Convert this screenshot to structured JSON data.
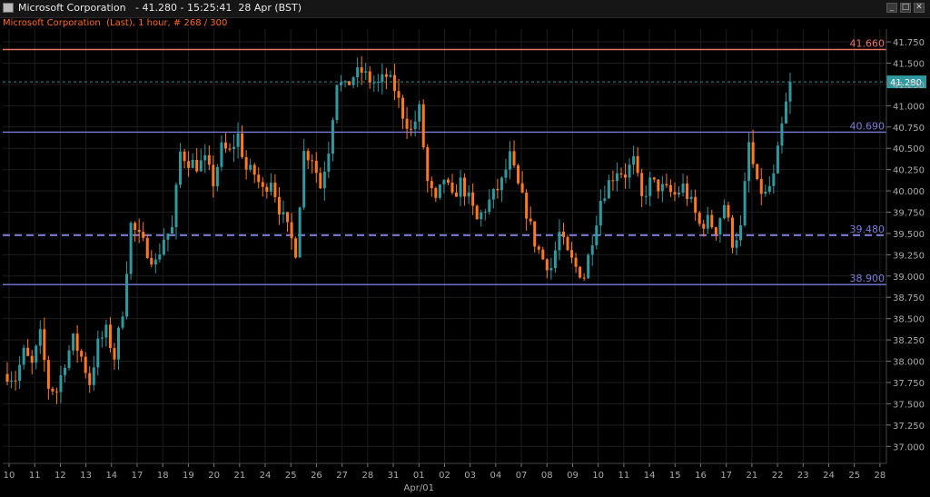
{
  "window": {
    "title": "Microsoft Corporation   - 41.280 - 15:25:41  28 Apr (BST)",
    "subtitle": "Microsoft Corporation  (Last), 1 hour, # 268 / 300",
    "controls": [
      "_",
      "□",
      "✕"
    ]
  },
  "colors": {
    "up": "#2e9aa0",
    "down": "#ff7a1e",
    "grid": "#1d1d1d",
    "axis": "#aaaaaa",
    "background": "#000000"
  },
  "chart_data": {
    "type": "candlestick",
    "title": "Microsoft Corporation",
    "ylim": [
      36.8,
      41.9
    ],
    "y_ticks": [
      "37.000",
      "37.250",
      "37.500",
      "37.750",
      "38.000",
      "38.250",
      "38.500",
      "38.750",
      "39.000",
      "39.250",
      "39.500",
      "39.750",
      "40.000",
      "40.250",
      "40.500",
      "40.750",
      "41.000",
      "41.250",
      "41.500",
      "41.750"
    ],
    "x_ticks": [
      "10",
      "11",
      "12",
      "13",
      "14",
      "17",
      "18",
      "19",
      "20",
      "21",
      "24",
      "25",
      "26",
      "27",
      "28",
      "31",
      "01",
      "02",
      "03",
      "04",
      "07",
      "08",
      "09",
      "10",
      "11",
      "14",
      "15",
      "16",
      "17",
      "21",
      "22",
      "23",
      "24",
      "25",
      "28"
    ],
    "x_sublabel": {
      "under": "01",
      "text": "Apr/01"
    },
    "last_price": {
      "label": "41.280",
      "value": 41.28
    },
    "levels": [
      {
        "label": "41.660",
        "value": 41.66,
        "color": "#e8736b",
        "style": "solid"
      },
      {
        "label": "40.690",
        "value": 40.69,
        "color": "#7b7bd8",
        "style": "solid"
      },
      {
        "label": "39.480",
        "value": 39.48,
        "color": "#7b7bd8",
        "style": "dashed"
      },
      {
        "label": "38.900",
        "value": 38.9,
        "color": "#7b7bd8",
        "style": "solid"
      }
    ],
    "candles_per_day": 8,
    "path": [
      37.85,
      37.8,
      38.1,
      37.95,
      38.3,
      37.7,
      37.65,
      38.0,
      38.25,
      38.05,
      37.75,
      38.2,
      38.35,
      38.05,
      38.6,
      39.6,
      39.45,
      39.3,
      39.15,
      39.45,
      39.55,
      40.45,
      40.35,
      40.3,
      40.35,
      40.1,
      40.5,
      40.45,
      40.65,
      40.25,
      40.2,
      40.0,
      40.15,
      39.8,
      39.55,
      39.3,
      40.45,
      40.4,
      40.05,
      40.5,
      41.3,
      41.2,
      41.35,
      41.4,
      41.3,
      41.25,
      41.35,
      41.2,
      40.9,
      40.7,
      40.95,
      40.1,
      39.85,
      40.15,
      39.9,
      40.1,
      39.9,
      39.65,
      39.8,
      39.95,
      40.1,
      40.4,
      40.05,
      39.75,
      39.4,
      39.2,
      39.1,
      39.5,
      39.25,
      39.1,
      39.0,
      39.45,
      39.9,
      40.1,
      40.25,
      40.2,
      40.35,
      39.9,
      40.1,
      40.05,
      40.0,
      39.95,
      40.05,
      39.85,
      39.6,
      39.65,
      39.55,
      39.85,
      39.4,
      39.55,
      40.55,
      40.05,
      39.95,
      40.15,
      40.75,
      41.28
    ]
  }
}
